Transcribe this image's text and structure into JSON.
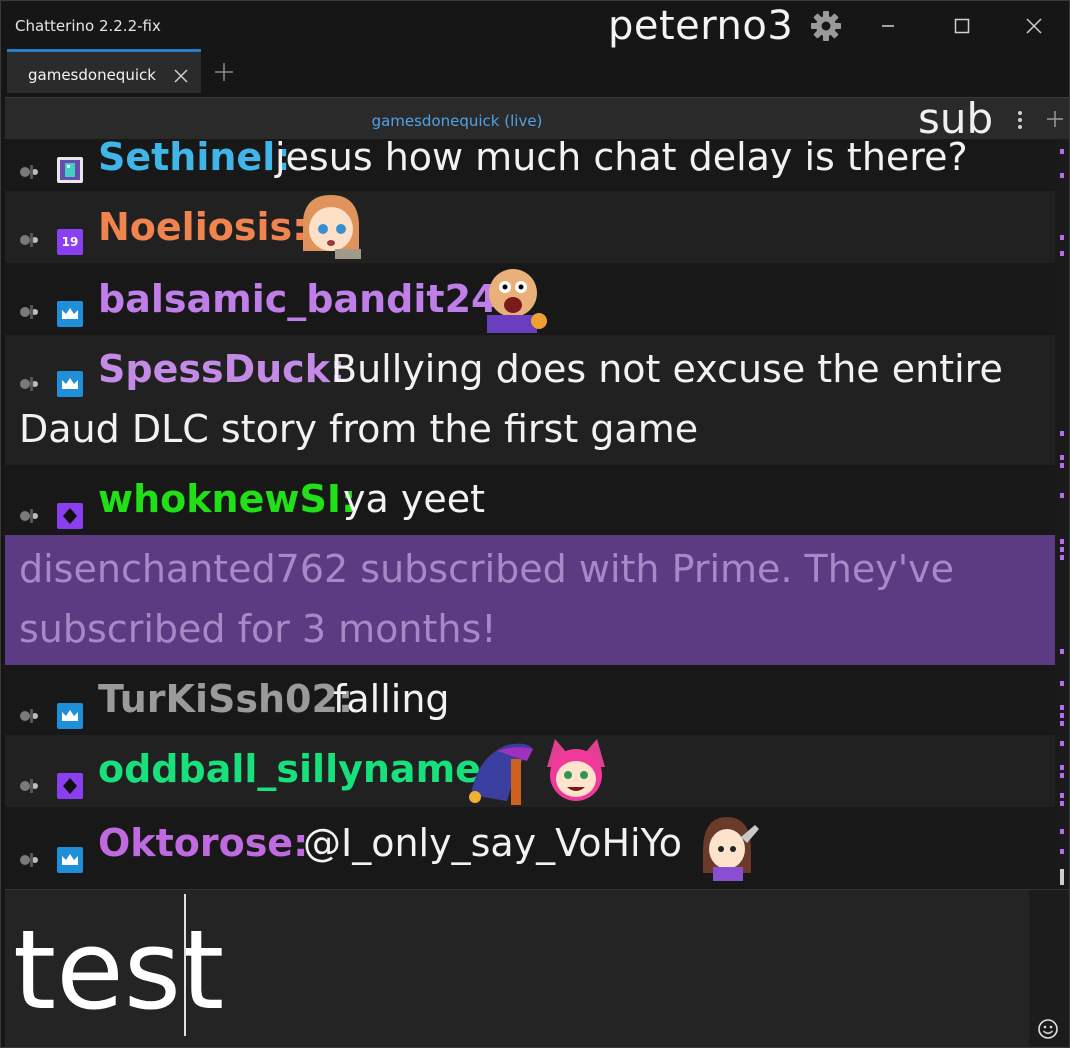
{
  "window": {
    "app_title": "Chatterino 2.2.2-fix",
    "user": "peterno3"
  },
  "tabs": [
    {
      "label": "gamesdonequick"
    }
  ],
  "split": {
    "channel_title": "gamesdonequick (live)",
    "overlay_text": "sub"
  },
  "messages": [
    {
      "user": "Sethinel:",
      "text": "jesus how much chat delay is there?",
      "color": "#3fb5e8"
    },
    {
      "user": "Noeliosis:",
      "text": "",
      "color": "#f0844e"
    },
    {
      "user": "balsamic_bandit24:",
      "text": "",
      "color": "#c07ee8"
    },
    {
      "user": "SpessDuck:",
      "text": "Bullying does not excuse the entire",
      "text2": "Daud DLC story from the first game",
      "color": "#c38ae6"
    },
    {
      "user": "whoknewSI:",
      "text": "ya yeet",
      "color": "#22e018"
    },
    {
      "system_line1": "disenchanted762 subscribed with Prime. They've",
      "system_line2": "subscribed for 3 months!"
    },
    {
      "user": "TurKiSsh02:",
      "text": "falling",
      "color": "#9a9a9a"
    },
    {
      "user": "oddball_sillyname:",
      "text": "",
      "color": "#18e07a"
    },
    {
      "user": "Oktorose:",
      "text": "@I_only_say_VoHiYo",
      "color": "#c06ae0"
    }
  ],
  "badges": {
    "sub_badge_text": "19"
  },
  "input": {
    "value": "test"
  },
  "colors": {
    "accent": "#2680c9",
    "sub_notice_bg": "#5d3b82",
    "scroll_tick": "#b86cf0"
  },
  "icons": {
    "settings": "gear-icon",
    "minimize": "minimize-icon",
    "maximize": "maximize-icon",
    "close": "close-icon",
    "emoji": "emoji-icon"
  }
}
